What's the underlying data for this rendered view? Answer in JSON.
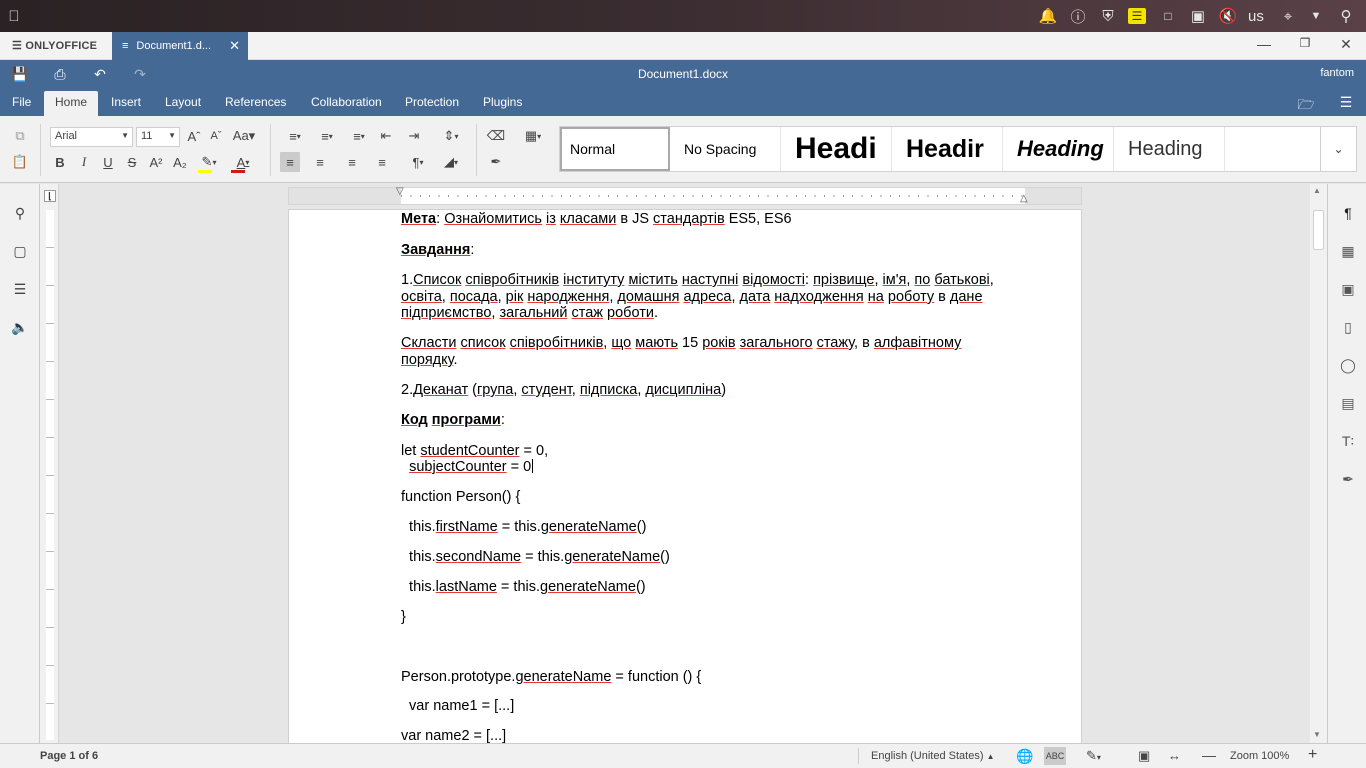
{
  "system": {
    "icons": [
      "apple-icon",
      "bell-icon",
      "info-icon",
      "shield-icon",
      "notes-icon",
      "terminal-icon",
      "clipboard-icon",
      "mute-icon",
      "wifi-icon",
      "dropdown-icon",
      "search-icon"
    ],
    "keyboard_layout": "us"
  },
  "app": {
    "logo": "ONLYOFFICE",
    "tab_title": "Document1.d..."
  },
  "header": {
    "doc_title": "Document1.docx",
    "user": "fantom",
    "menu": [
      "File",
      "Home",
      "Insert",
      "Layout",
      "References",
      "Collaboration",
      "Protection",
      "Plugins"
    ],
    "active_menu": "Home"
  },
  "toolbar": {
    "font_name": "Arial",
    "font_size": "11",
    "styles": [
      "Normal",
      "No Spacing",
      "Headi",
      "Headir",
      "Heading",
      "Heading"
    ],
    "selected_style": "Normal",
    "highlight_color": "#ffff00",
    "font_color": "#d01a1a"
  },
  "document": {
    "lines": [
      {
        "parts": [
          {
            "t": "Мета",
            "b": 1,
            "s": 1
          },
          {
            "t": ": "
          },
          {
            "t": "Ознайомитись",
            "s": 1
          },
          {
            "t": " "
          },
          {
            "t": "із",
            "s": 1
          },
          {
            "t": " "
          },
          {
            "t": "класами",
            "s": 1
          },
          {
            "t": " в JS "
          },
          {
            "t": "стандартів",
            "s": 1
          },
          {
            "t": " ES5, ES6"
          }
        ]
      },
      {
        "parts": [
          {
            "t": "Завдання",
            "b": 1,
            "s": 1
          },
          {
            "t": ":"
          }
        ]
      },
      {
        "parts": [
          {
            "t": "1."
          },
          {
            "t": "Список",
            "s": 1
          },
          {
            "t": " "
          },
          {
            "t": "співробітників",
            "s": 1
          },
          {
            "t": " "
          },
          {
            "t": "інституту",
            "s": 1
          },
          {
            "t": " "
          },
          {
            "t": "містить",
            "s": 1
          },
          {
            "t": " "
          },
          {
            "t": "наступні",
            "s": 1
          },
          {
            "t": " "
          },
          {
            "t": "відомості",
            "s": 1
          },
          {
            "t": ": "
          },
          {
            "t": "прізвище",
            "s": 1
          },
          {
            "t": ", "
          },
          {
            "t": "ім'я",
            "s": 1
          },
          {
            "t": ", "
          },
          {
            "t": "по",
            "s": 1
          },
          {
            "t": " "
          },
          {
            "t": "батькові",
            "s": 1
          },
          {
            "t": ","
          }
        ]
      },
      {
        "parts": [
          {
            "t": "освіта",
            "s": 1
          },
          {
            "t": ", "
          },
          {
            "t": "посада",
            "s": 1
          },
          {
            "t": ", "
          },
          {
            "t": "рік",
            "s": 1
          },
          {
            "t": " "
          },
          {
            "t": "народження",
            "s": 1
          },
          {
            "t": ", "
          },
          {
            "t": "домашня",
            "s": 1
          },
          {
            "t": " "
          },
          {
            "t": "адреса",
            "s": 1
          },
          {
            "t": ", "
          },
          {
            "t": "дата",
            "s": 1
          },
          {
            "t": " "
          },
          {
            "t": "надходження",
            "s": 1
          },
          {
            "t": " "
          },
          {
            "t": "на",
            "s": 1
          },
          {
            "t": " "
          },
          {
            "t": "роботу",
            "s": 1
          },
          {
            "t": " в "
          },
          {
            "t": "дане",
            "s": 1
          }
        ]
      },
      {
        "parts": [
          {
            "t": "підприємство",
            "s": 1
          },
          {
            "t": ", "
          },
          {
            "t": "загальний",
            "s": 1
          },
          {
            "t": " "
          },
          {
            "t": "стаж",
            "s": 1
          },
          {
            "t": " "
          },
          {
            "t": "роботи",
            "s": 1
          },
          {
            "t": "."
          }
        ]
      },
      {
        "parts": [
          {
            "t": "Скласти",
            "s": 1
          },
          {
            "t": " "
          },
          {
            "t": "список",
            "s": 1
          },
          {
            "t": " "
          },
          {
            "t": "співробітників",
            "s": 1
          },
          {
            "t": ", "
          },
          {
            "t": "що",
            "s": 1
          },
          {
            "t": " "
          },
          {
            "t": "мають",
            "s": 1
          },
          {
            "t": " 15 "
          },
          {
            "t": "років",
            "s": 1
          },
          {
            "t": " "
          },
          {
            "t": "загального",
            "s": 1
          },
          {
            "t": " "
          },
          {
            "t": "стажу",
            "s": 1
          },
          {
            "t": ", в "
          },
          {
            "t": "алфавітному",
            "s": 1
          }
        ]
      },
      {
        "parts": [
          {
            "t": "порядку",
            "s": 1
          },
          {
            "t": "."
          }
        ]
      },
      {
        "parts": [
          {
            "t": "2."
          },
          {
            "t": "Деканат",
            "s": 1
          },
          {
            "t": " ("
          },
          {
            "t": "група",
            "s": 1
          },
          {
            "t": ", "
          },
          {
            "t": "студент",
            "s": 1
          },
          {
            "t": ", "
          },
          {
            "t": "підписка",
            "s": 1
          },
          {
            "t": ", "
          },
          {
            "t": "дисципліна",
            "s": 1
          },
          {
            "t": ")"
          }
        ]
      },
      {
        "parts": [
          {
            "t": "Код",
            "b": 1,
            "s": 1
          },
          {
            "t": " ",
            "b": 1
          },
          {
            "t": "програми",
            "b": 1,
            "s": 1
          },
          {
            "t": ":"
          }
        ]
      },
      {
        "parts": [
          {
            "t": "let "
          },
          {
            "t": "studentCounter",
            "s": 1
          },
          {
            "t": " = 0,"
          }
        ]
      },
      {
        "parts": [
          {
            "t": "  "
          },
          {
            "t": "subjectCounter",
            "s": 1
          },
          {
            "t": " = 0"
          }
        ]
      },
      {
        "parts": [
          {
            "t": "function Person() {"
          }
        ]
      },
      {
        "parts": [
          {
            "t": "  this."
          },
          {
            "t": "firstName",
            "s": 1
          },
          {
            "t": " = this."
          },
          {
            "t": "generateName",
            "s": 1
          },
          {
            "t": "()"
          }
        ]
      },
      {
        "parts": [
          {
            "t": "  this."
          },
          {
            "t": "secondName",
            "s": 1
          },
          {
            "t": " = this."
          },
          {
            "t": "generateName",
            "s": 1
          },
          {
            "t": "()"
          }
        ]
      },
      {
        "parts": [
          {
            "t": "  this."
          },
          {
            "t": "lastName",
            "s": 1
          },
          {
            "t": " = this."
          },
          {
            "t": "generateName",
            "s": 1
          },
          {
            "t": "()"
          }
        ]
      },
      {
        "parts": [
          {
            "t": "}"
          }
        ]
      },
      {
        "parts": [
          {
            "t": "Person.prototype."
          },
          {
            "t": "generateName",
            "s": 1
          },
          {
            "t": " = function () {"
          }
        ]
      },
      {
        "parts": [
          {
            "t": "  var name1 = [...]"
          }
        ]
      },
      {
        "parts": [
          {
            "t": "var name2 = [...]"
          }
        ]
      }
    ]
  },
  "status": {
    "page": "Page 1 of 6",
    "language": "English (United States)",
    "zoom": "Zoom 100%"
  }
}
